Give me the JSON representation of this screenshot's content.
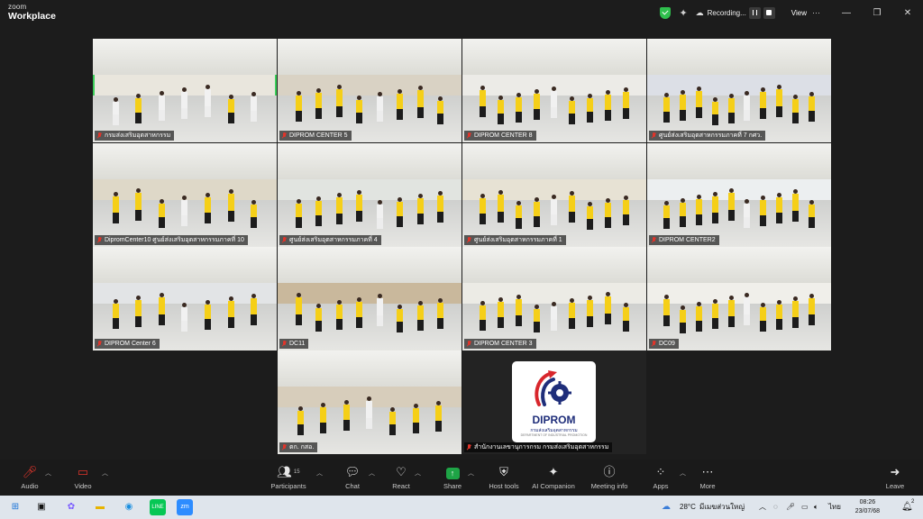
{
  "app": {
    "brand_small": "zoom",
    "brand_name": "Workplace"
  },
  "titlebar": {
    "recording_label": "Recording...",
    "view_label": "View",
    "icons": [
      "shield-icon",
      "sparkle-icon",
      "cloud-icon",
      "pause-icon",
      "stop-icon",
      "minimize-icon",
      "restore-icon",
      "close-icon"
    ]
  },
  "tiles": [
    {
      "name": "กรมส่งเสริมอุตสาหกรรม",
      "active": true
    },
    {
      "name": "DIPROM CENTER 5"
    },
    {
      "name": "DIPROM CENTER 8"
    },
    {
      "name": "ศูนย์ส่งเสริมอุตสาหกรรมภาคที่ 7 กศว."
    },
    {
      "name": "DipromCenter10 ศูนย์ส่งเสริมอุตสาหกรรมภาคที่ 10"
    },
    {
      "name": "ศูนย์ส่งเสริมอุตสาหกรรมภาคที่ 4"
    },
    {
      "name": "ศูนย์ส่งเสริมอุตสาหกรรมภาคที่ 1"
    },
    {
      "name": "DIPROM CENTER2"
    },
    {
      "name": "DIPROM Center 6"
    },
    {
      "name": "DC11"
    },
    {
      "name": "DIPROM CENTER 3"
    },
    {
      "name": "DC09"
    },
    {
      "name": "ตก. กสอ."
    },
    {
      "name": "สำนักงานเลขานุการกรม กรมส่งเสริมอุตสาหกรรม"
    }
  ],
  "logo_tile": {
    "title": "DIPROM",
    "subtitle": "กรมส่งเสริมอุตสาหกรรม",
    "subtitle2": "DEPARTMENT OF INDUSTRIAL PROMOTION",
    "colors": {
      "navy": "#1f2e7a",
      "red": "#d8262c"
    }
  },
  "toolbar": {
    "audio": "Audio",
    "video": "Video",
    "participants": "Participants",
    "participants_count": "15",
    "chat": "Chat",
    "react": "React",
    "share": "Share",
    "host_tools": "Host tools",
    "ai_companion": "AI Companion",
    "meeting_info": "Meeting info",
    "apps": "Apps",
    "more": "More",
    "leave": "Leave"
  },
  "taskbar": {
    "weather": "28°C",
    "weather_text": "มีเมฆส่วนใหญ่",
    "lang": "ไทย",
    "time": "08:26",
    "date": "23/07/68",
    "notifications": "2"
  },
  "colors": {
    "active_speaker": "#3ccf5a",
    "share_green": "#1ea446",
    "muted_red": "#e0352b",
    "uniform_yellow": "#f5cf18"
  }
}
